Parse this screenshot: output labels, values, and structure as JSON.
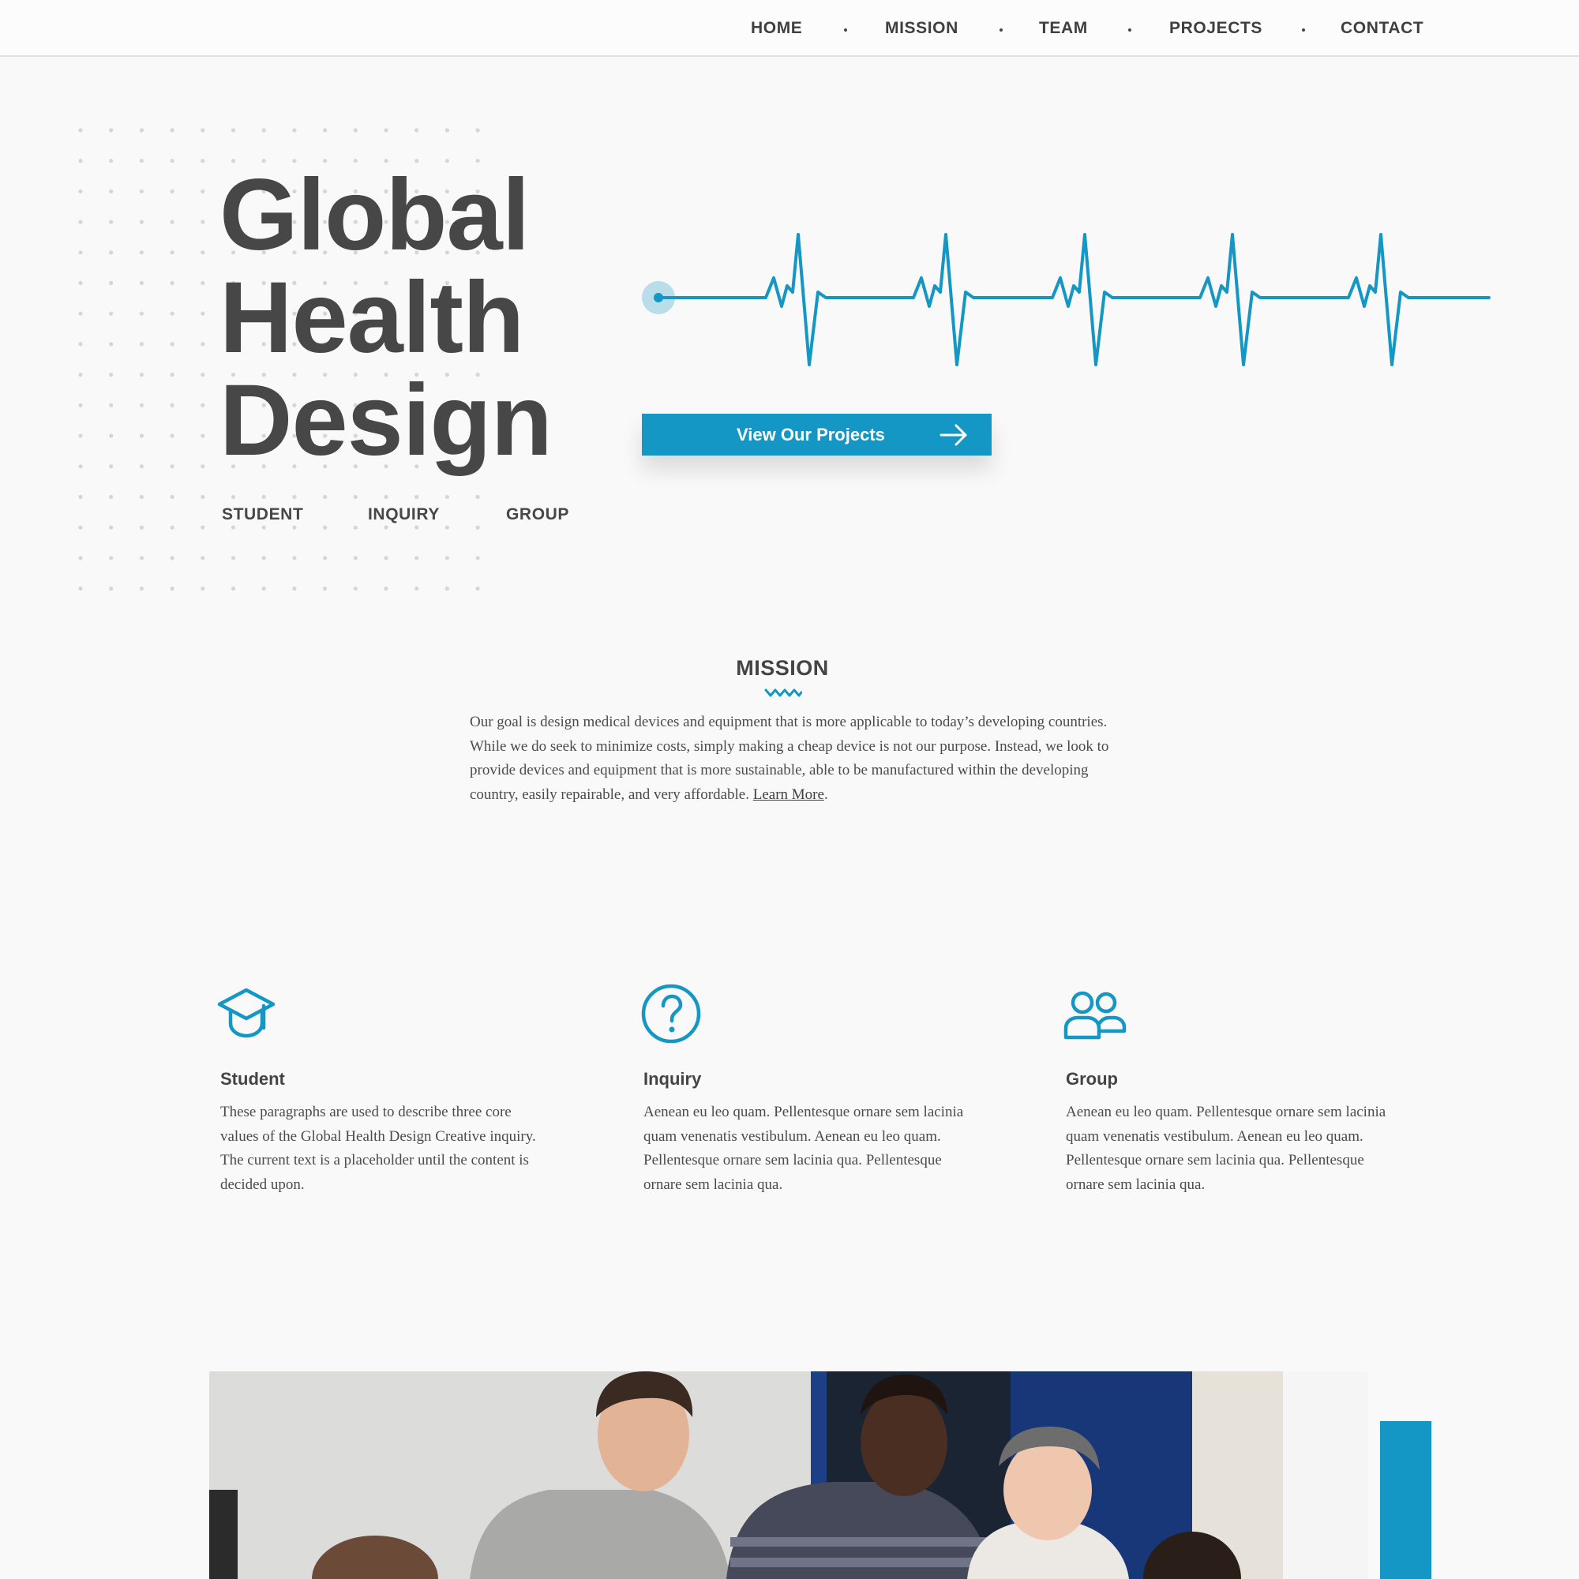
{
  "nav": {
    "items": [
      {
        "label": "HOME"
      },
      {
        "label": "MISSION"
      },
      {
        "label": "TEAM"
      },
      {
        "label": "PROJECTS"
      },
      {
        "label": "CONTACT"
      }
    ]
  },
  "hero": {
    "title_lines": [
      "Global",
      "Health",
      "Design"
    ],
    "tags": [
      "STUDENT",
      "INQUIRY",
      "GROUP"
    ],
    "cta_label": "View Our Projects",
    "cta_icon": "arrow-right-icon",
    "accent_color": "#1497c4"
  },
  "mission": {
    "heading": "MISSION",
    "body": "Our goal is design medical devices and equipment that is more applicable to today’s developing countries. While we do seek to minimize costs, simply making a cheap device is not our purpose. Instead, we look to provide devices and equipment that is more sustainable, able to be manufactured within the developing country, easily repairable, and very affordable. ",
    "link_label": "Learn More",
    "after_link": "."
  },
  "cards": [
    {
      "icon": "graduation-cap-icon",
      "title": "Student",
      "body": "These paragraphs are used to describe three core values of the Global Health Design Creative inquiry.  The current text is a placeholder until the content is decided upon."
    },
    {
      "icon": "question-circle-icon",
      "title": "Inquiry",
      "body": "Aenean eu leo quam. Pellentesque ornare sem lacinia quam venenatis vestibulum. Aenean eu leo quam. Pellentesque ornare sem lacinia qua.  Pellentesque ornare sem lacinia qua."
    },
    {
      "icon": "group-icon",
      "title": "Group",
      "body": "Aenean eu leo quam. Pellentesque ornare sem lacinia quam venenatis vestibulum. Aenean eu leo quam. Pellentesque ornare sem lacinia qua.  Pellentesque ornare sem lacinia qua."
    }
  ],
  "photo": {
    "icon": "team-photo"
  }
}
